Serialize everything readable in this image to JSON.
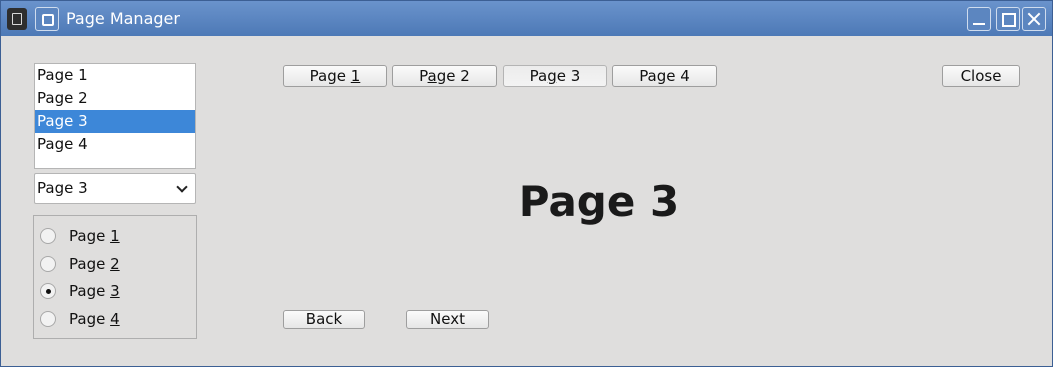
{
  "window": {
    "title": "Page Manager"
  },
  "list": {
    "items": [
      "Page 1",
      "Page 2",
      "Page 3",
      "Page 4"
    ],
    "selected_index": 2
  },
  "combo": {
    "value": "Page 3"
  },
  "radios": {
    "items": [
      {
        "prefix": "Page ",
        "mnemonic": "1"
      },
      {
        "prefix": "Page ",
        "mnemonic": "2"
      },
      {
        "prefix": "Page ",
        "mnemonic": "3"
      },
      {
        "prefix": "Page ",
        "mnemonic": "4"
      }
    ],
    "checked_index": 2
  },
  "tabs": [
    {
      "pre": "Page ",
      "mn": "1",
      "post": ""
    },
    {
      "pre": "P",
      "mn": "a",
      "post": "ge 2"
    },
    {
      "pre": "Pa",
      "mn": "g",
      "post": "e 3"
    },
    {
      "pre": "Page 4",
      "mn": "",
      "post": ""
    }
  ],
  "close_label": "Close",
  "content": {
    "heading": "Page 3"
  },
  "nav": {
    "back": "Back",
    "next": "Next"
  }
}
